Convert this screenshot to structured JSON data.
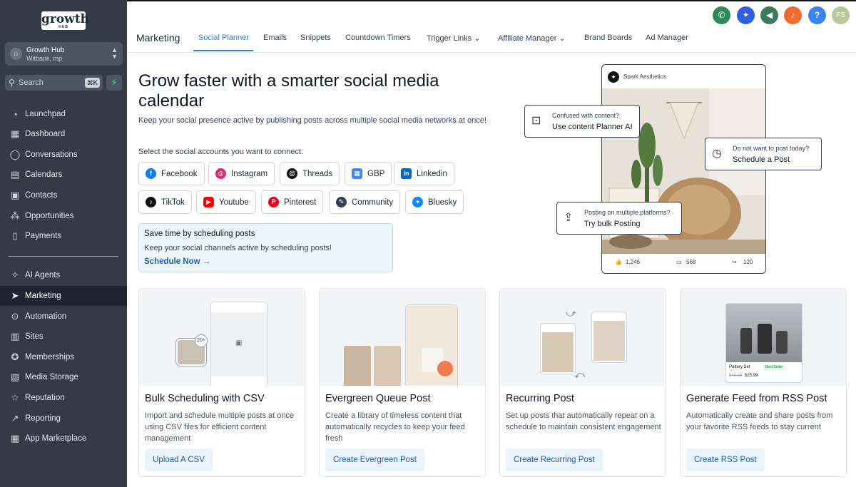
{
  "sidebar": {
    "logo_main": "growth",
    "logo_sub": "HUB",
    "account_name": "Growth Hub",
    "account_location": "Witbank, mp",
    "search_placeholder": "Search",
    "search_shortcut": "⌘K",
    "items": [
      {
        "label": "Launchpad",
        "icon": "rocket-icon"
      },
      {
        "label": "Dashboard",
        "icon": "grid-icon"
      },
      {
        "label": "Conversations",
        "icon": "chat-icon"
      },
      {
        "label": "Calendars",
        "icon": "calendar-icon"
      },
      {
        "label": "Contacts",
        "icon": "contacts-icon"
      },
      {
        "label": "Opportunities",
        "icon": "network-icon"
      },
      {
        "label": "Payments",
        "icon": "payments-icon"
      },
      {
        "label": "AI Agents",
        "icon": "sparkle-icon"
      },
      {
        "label": "Marketing",
        "icon": "send-icon"
      },
      {
        "label": "Automation",
        "icon": "automation-icon"
      },
      {
        "label": "Sites",
        "icon": "sites-icon"
      },
      {
        "label": "Memberships",
        "icon": "membership-icon"
      },
      {
        "label": "Media Storage",
        "icon": "image-icon"
      },
      {
        "label": "Reputation",
        "icon": "star-icon"
      },
      {
        "label": "Reporting",
        "icon": "chart-icon"
      },
      {
        "label": "App Marketplace",
        "icon": "apps-icon"
      }
    ]
  },
  "header": {
    "section": "Marketing",
    "tabs": [
      "Social Planner",
      "Emails",
      "Snippets",
      "Countdown Timers",
      "Trigger Links",
      "Affiliate Manager",
      "Brand Boards",
      "Ad Manager"
    ],
    "avatar_initials": "FS",
    "help_glyph": "?",
    "colors": {
      "phone": "#2e8b57",
      "ai": "#2f5fe0",
      "megaphone": "#3d7a5c",
      "bell": "#f26b2e",
      "help": "#3b82f6",
      "avatar": "#b7c79a"
    }
  },
  "hero": {
    "title": "Grow faster with a smarter social media calendar",
    "subtitle": "Keep your social presence active by publishing posts across multiple social media networks at once!",
    "select_label": "Select the social accounts you want to connect:",
    "accounts": [
      {
        "label": "Facebook",
        "glyph": "f",
        "color": "#1877f2"
      },
      {
        "label": "Instagram",
        "glyph": "◎",
        "color": "#d62976"
      },
      {
        "label": "Threads",
        "glyph": "@",
        "color": "#111111"
      },
      {
        "label": "GBP",
        "glyph": "▦",
        "color": "#4285f4"
      },
      {
        "label": "Linkedin",
        "glyph": "in",
        "color": "#0a66c2"
      },
      {
        "label": "TikTok",
        "glyph": "♪",
        "color": "#111111"
      },
      {
        "label": "Youtube",
        "glyph": "▶",
        "color": "#ff0000"
      },
      {
        "label": "Pinterest",
        "glyph": "P",
        "color": "#e60023"
      },
      {
        "label": "Community",
        "glyph": "✎",
        "color": "#374151"
      },
      {
        "label": "Bluesky",
        "glyph": "✦",
        "color": "#1185fe"
      }
    ],
    "schedule_box": {
      "title": "Save time by scheduling posts",
      "desc": "Keep your social channels active by scheduling posts!",
      "link": "Schedule Now"
    }
  },
  "mockup": {
    "brand": "Spark Aesthetics",
    "likes": "1,246",
    "comments": "568",
    "shares": "120",
    "callouts": [
      {
        "line1": "Confused with content?",
        "line2": "Use content Planner AI"
      },
      {
        "line1": "Do not want to post today?",
        "line2": "Schedule a Post"
      },
      {
        "line1": "Posting on multiple platforms?",
        "line2": "Try bulk Posting"
      }
    ]
  },
  "cards": [
    {
      "title": "Bulk Scheduling with CSV",
      "desc": "Import and schedule multiple posts at once using CSV files for efficient content management",
      "button": "Upload A CSV",
      "badge": "20+"
    },
    {
      "title": "Evergreen Queue Post",
      "desc": "Create a library of timeless content that automatically recycles to keep your feed fresh",
      "button": "Create Evergreen Post"
    },
    {
      "title": "Recurring Post",
      "desc": "Set up posts that automatically repeat on a schedule to maintain consistent engagement",
      "button": "Create Recurring Post"
    },
    {
      "title": "Generate Feed from RSS Post",
      "desc": "Automatically create and share posts from your favorite RSS feeds to stay current",
      "button": "Create RSS Post",
      "product": "Pottery Set",
      "tag": "Best Seller",
      "old_price": "$49.98",
      "price": "$25.99"
    }
  ]
}
